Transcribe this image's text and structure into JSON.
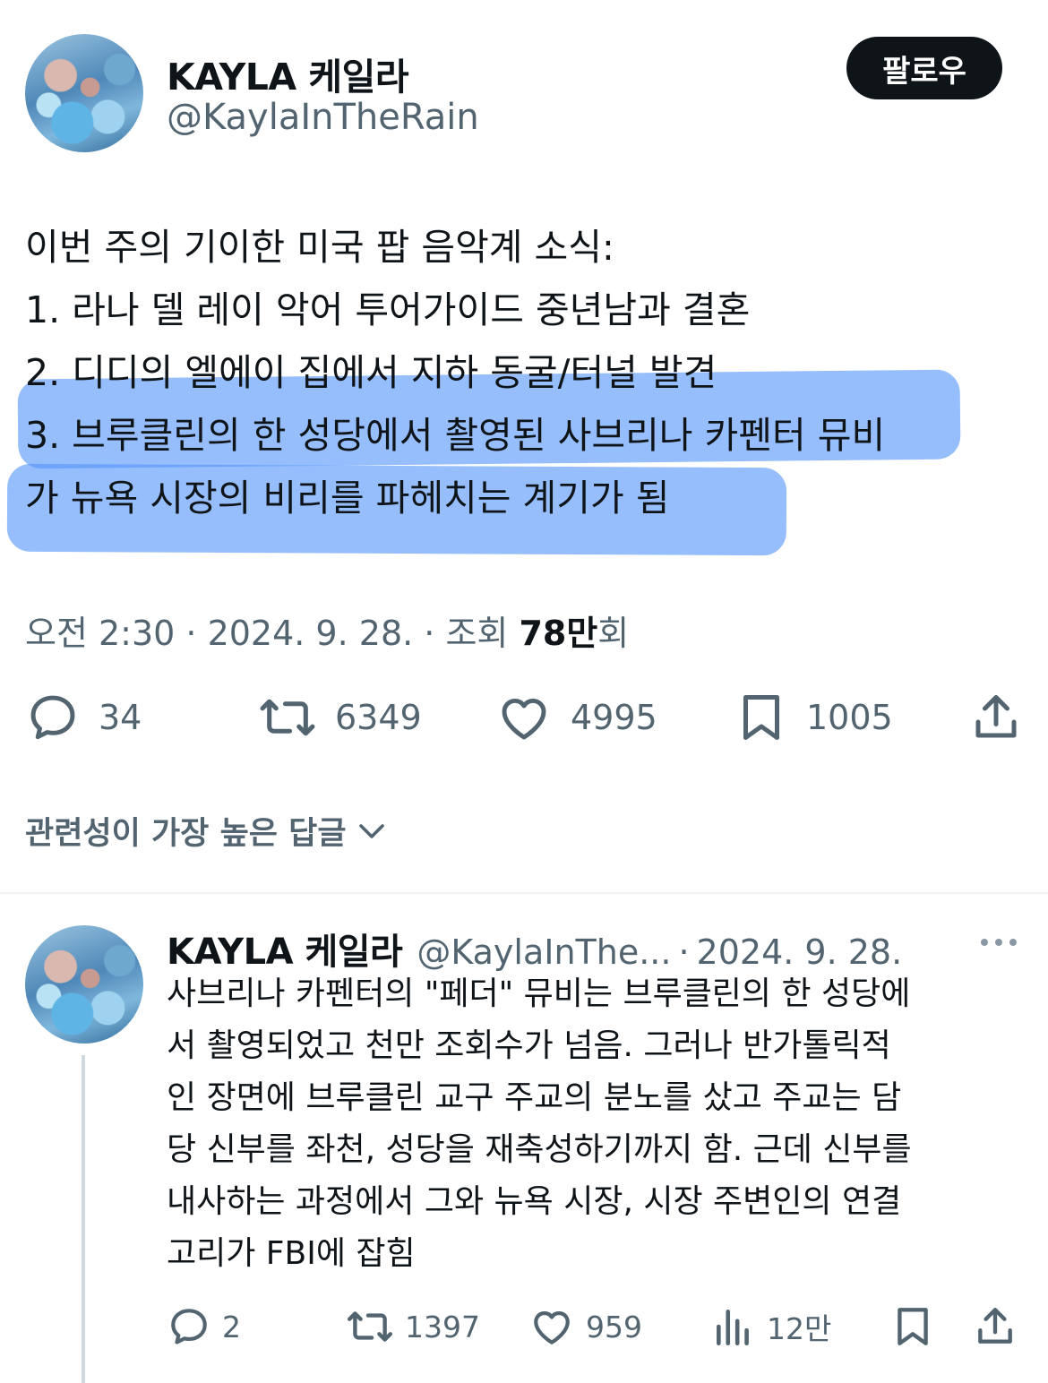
{
  "tweet": {
    "author": {
      "display_name": "KAYLA 케일라",
      "handle": "@KaylaInTheRain"
    },
    "follow_label": "팔로우",
    "lines": [
      "이번 주의 기이한 미국 팝 음악계 소식:",
      "1. 라나 델 레이 악어 투어가이드 중년남과 결혼",
      "2. 디디의 엘에이 집에서 지하 동굴/터널 발견",
      "3. 브루클린의 한 성당에서 촬영된 사브리나 카펜터 뮤비",
      "가 뉴욕 시장의 비리를 파헤치는 계기가 됨"
    ],
    "meta": {
      "time_date": "오전 2:30 · 2024. 9. 28. · 조회 ",
      "views_number": "78만",
      "views_suffix": "회"
    },
    "actions": {
      "replies": "34",
      "reposts": "6349",
      "likes": "4995",
      "bookmarks": "1005"
    }
  },
  "replies_sort": {
    "label": "관련성이 가장 높은 답글"
  },
  "reply": {
    "author": {
      "display_name": "KAYLA 케일라",
      "handle": "@KaylaInThe...",
      "date": "2024. 9. 28."
    },
    "separator": "·",
    "lines": [
      "사브리나 카펜터의 \"페더\" 뮤비는 브루클린의 한 성당에",
      "서 촬영되었고 천만 조회수가 넘음. 그러나 반가톨릭적",
      "인 장면에 브루클린 교구 주교의 분노를 샀고 주교는 담",
      "당 신부를 좌천, 성당을 재축성하기까지 함. 근데 신부를",
      "내사하는 과정에서 그와 뉴욕 시장, 시장 주변인의 연결",
      "고리가 FBI에 잡힘"
    ],
    "actions": {
      "replies": "2",
      "reposts": "1397",
      "likes": "959",
      "views": "12만"
    }
  },
  "colors": {
    "highlight": "#5696fa",
    "text_primary": "#0f1419",
    "text_secondary": "#536471",
    "follow_bg": "#0f1419"
  },
  "icons": [
    "reply-icon",
    "repost-icon",
    "like-icon",
    "bookmark-icon",
    "share-icon",
    "chevron-down-icon",
    "more-icon",
    "views-icon"
  ]
}
